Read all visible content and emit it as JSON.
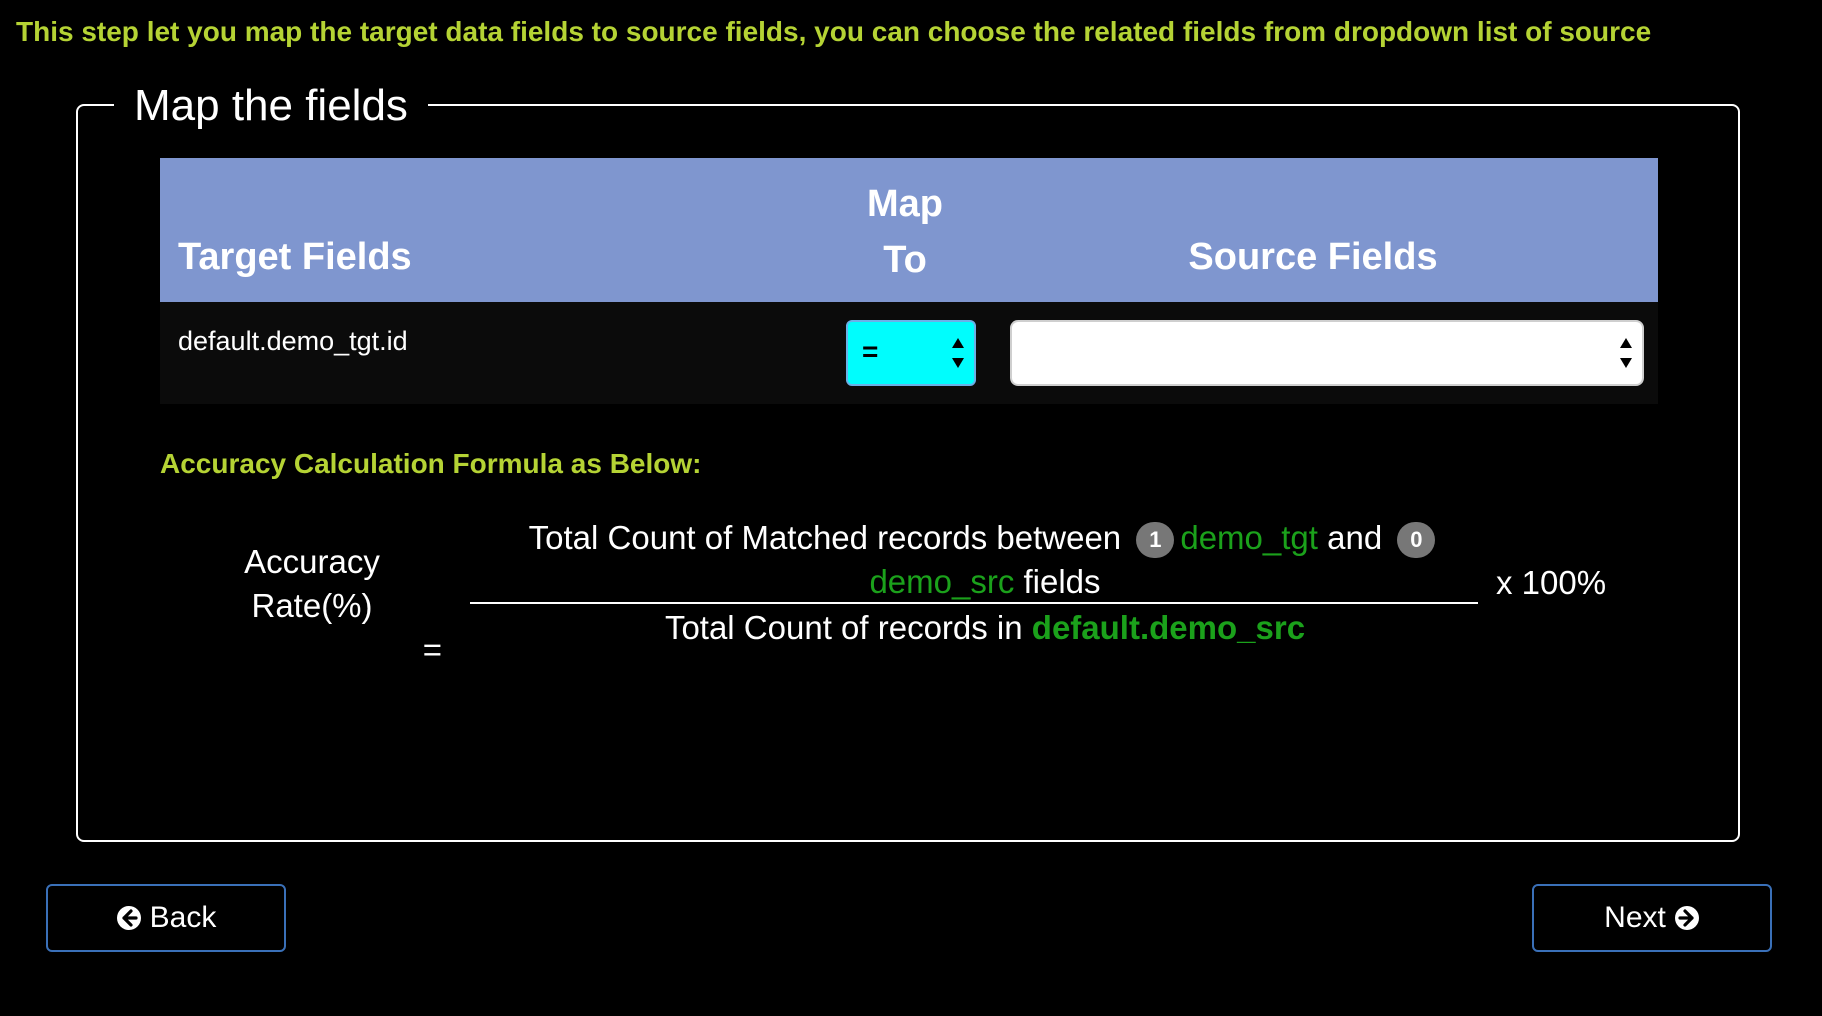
{
  "intro_text": "This step let you map the target data fields to source fields, you can choose the related fields from dropdown list of source",
  "panel": {
    "legend": "Map the fields",
    "table": {
      "headers": {
        "target": "Target Fields",
        "map_line1": "Map",
        "map_line2": "To",
        "source": "Source Fields"
      },
      "rows": [
        {
          "target": "default.demo_tgt.id",
          "operator": "=",
          "source": ""
        }
      ]
    },
    "formula": {
      "title": "Accuracy Calculation Formula as Below:",
      "label_line1": "Accuracy Rate(%)",
      "label_line2": "=",
      "numerator_text1": "Total Count of Matched records between",
      "badge_tgt": "1",
      "tgt_name": "demo_tgt",
      "and_text": "and",
      "badge_src": "0",
      "src_name": "demo_src",
      "fields_text": "fields",
      "denominator_text": "Total Count of records in",
      "denominator_table": "default.demo_src",
      "multiplier": "x 100%"
    }
  },
  "buttons": {
    "back": "Back",
    "next": "Next"
  },
  "icons": {
    "back": "arrow-circle-left-icon",
    "next": "arrow-circle-right-icon"
  },
  "colors": {
    "accent_green": "#b5d334",
    "table_header": "#7f96cf",
    "operator_select": "#00fdfd",
    "highlight_green": "#1ba11b"
  }
}
